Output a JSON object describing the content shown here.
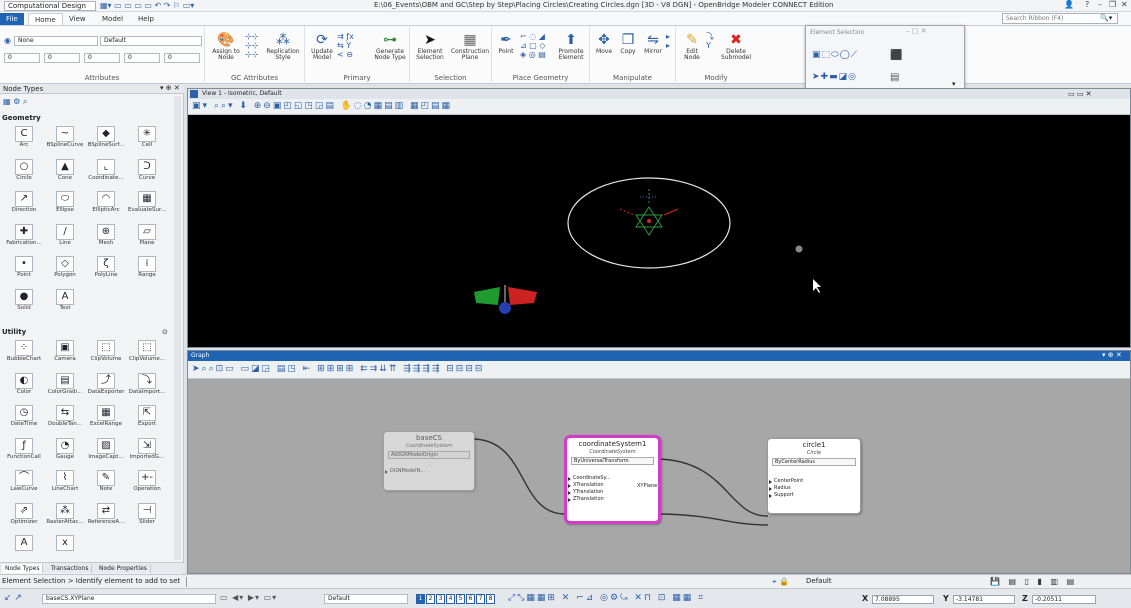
{
  "titlebar": {
    "workflow": "Computational Design",
    "title": "E:\\06_Events\\OBM and GC\\Step by Step\\Placing Circles\\Creating Circles.dgn [3D - V8 DGN] - OpenBridge Modeler CONNECT Edition"
  },
  "menu": {
    "file": "File",
    "tabs": [
      "Home",
      "View",
      "Model",
      "Help"
    ],
    "search_placeholder": "Search Ribbon (F4)"
  },
  "ribbon": {
    "attributes": {
      "label": "Attributes",
      "level": "None",
      "style": "Default",
      "weight1": "0",
      "weight2": "0",
      "weight3": "0",
      "weight4": "0",
      "weight5": "0"
    },
    "gc_attributes": {
      "label": "GC Attributes",
      "assign": "Assign to Node",
      "replication": "Replication Style"
    },
    "primary": {
      "label": "Primary",
      "update": "Update Model",
      "generate": "Generate Node Type"
    },
    "selection": {
      "label": "Selection",
      "element": "Element Selection",
      "construction": "Construction Plane"
    },
    "place_geometry": {
      "label": "Place Geometry",
      "point": "Point",
      "promote": "Promote Element"
    },
    "manipulate": {
      "label": "Manipulate",
      "move": "Move",
      "copy": "Copy",
      "mirror": "Mirror"
    },
    "modify": {
      "label": "Modify",
      "edit": "Edit Node",
      "delete": "Delete Submodel"
    }
  },
  "element_selection": {
    "title": "Element Selection"
  },
  "node_types": {
    "title": "Node Types",
    "geometry_label": "Geometry",
    "geometry": [
      {
        "icon": "C",
        "label": "Arc"
      },
      {
        "icon": "~",
        "label": "BSplineCurve"
      },
      {
        "icon": "◆",
        "label": "BSplineSurf..."
      },
      {
        "icon": "✳",
        "label": "Cell"
      },
      {
        "icon": "○",
        "label": "Circle"
      },
      {
        "icon": "▲",
        "label": "Cone"
      },
      {
        "icon": "⌞",
        "label": "Coordinate..."
      },
      {
        "icon": "ᑐ",
        "label": "Curve"
      },
      {
        "icon": "↗",
        "label": "Direction"
      },
      {
        "icon": "⬭",
        "label": "Ellipse"
      },
      {
        "icon": "◠",
        "label": "EllipticArc"
      },
      {
        "icon": "▦",
        "label": "EvaluateSur..."
      },
      {
        "icon": "✚",
        "label": "Fabrication..."
      },
      {
        "icon": "/",
        "label": "Line"
      },
      {
        "icon": "⊕",
        "label": "Mesh"
      },
      {
        "icon": "▱",
        "label": "Plane"
      },
      {
        "icon": "•",
        "label": "Point"
      },
      {
        "icon": "◇",
        "label": "Polygon"
      },
      {
        "icon": "ζ",
        "label": "PolyLine"
      },
      {
        "icon": "⁞",
        "label": "Range"
      },
      {
        "icon": "●",
        "label": "Solid"
      },
      {
        "icon": "A",
        "label": "Text"
      }
    ],
    "utility_label": "Utility",
    "utility": [
      {
        "icon": "⁘",
        "label": "BubbleChart"
      },
      {
        "icon": "▣",
        "label": "Camera"
      },
      {
        "icon": "⬚",
        "label": "ClipVolume"
      },
      {
        "icon": "⬚",
        "label": "ClipVolume..."
      },
      {
        "icon": "◐",
        "label": "Color"
      },
      {
        "icon": "▤",
        "label": "ColorGradi..."
      },
      {
        "icon": "⤴",
        "label": "DataExporter"
      },
      {
        "icon": "⤵",
        "label": "DataImport..."
      },
      {
        "icon": "◷",
        "label": "DateTime"
      },
      {
        "icon": "⇆",
        "label": "DoubleTan..."
      },
      {
        "icon": "▦",
        "label": "ExcelRange"
      },
      {
        "icon": "⇱",
        "label": "Export"
      },
      {
        "icon": "ƒ",
        "label": "FunctionCall"
      },
      {
        "icon": "◔",
        "label": "Gauge"
      },
      {
        "icon": "▨",
        "label": "ImageCapt..."
      },
      {
        "icon": "⇲",
        "label": "ImportedG..."
      },
      {
        "icon": "⌒",
        "label": "LawCurve"
      },
      {
        "icon": "⌇",
        "label": "LineChart"
      },
      {
        "icon": "✎",
        "label": "Note"
      },
      {
        "icon": "+-",
        "label": "Operation"
      },
      {
        "icon": "⇗",
        "label": "Optimizer"
      },
      {
        "icon": "⁂",
        "label": "RasterAttac..."
      },
      {
        "icon": "⇄",
        "label": "ReferenceA..."
      },
      {
        "icon": "⊣",
        "label": "Slider"
      },
      {
        "icon": "A",
        "label": ""
      },
      {
        "icon": "x",
        "label": ""
      }
    ],
    "tabs": [
      "Node Types",
      "Transactions",
      "Node Properties"
    ]
  },
  "view": {
    "title": "View 1 - Isometric, Default"
  },
  "graph": {
    "title": "Graph",
    "nodes": [
      {
        "name": "baseCS",
        "type": "CoordinateSystem",
        "technique": "AtDGNModelOrigin",
        "ports": [
          "DGNModelN..."
        ]
      },
      {
        "name": "coordinateSystem1",
        "type": "CoordinateSystem",
        "technique": "ByUniversalTransform",
        "ports": [
          "CoordinateSy...",
          "XTranslation",
          "YTranslation",
          "ZTranslation"
        ],
        "out": "XYPlane"
      },
      {
        "name": "circle1",
        "type": "Circle",
        "technique": "ByCenterRadius",
        "ports": [
          "CenterPoint",
          "Radius",
          "Support"
        ]
      }
    ]
  },
  "status": {
    "prompt": "Element Selection > Identify element to add to set",
    "level": "Default",
    "selected": "baseCS.XYPlane",
    "view_group": "Default",
    "views": [
      "1",
      "2",
      "3",
      "4",
      "5",
      "6",
      "7",
      "8"
    ],
    "x_label": "X",
    "x": "7.08895",
    "y_label": "Y",
    "y": "-3.14781",
    "z_label": "Z",
    "z": "-0.20511"
  },
  "colors": {
    "accent": "#1f64b3",
    "selected_node": "#d23cc9"
  }
}
